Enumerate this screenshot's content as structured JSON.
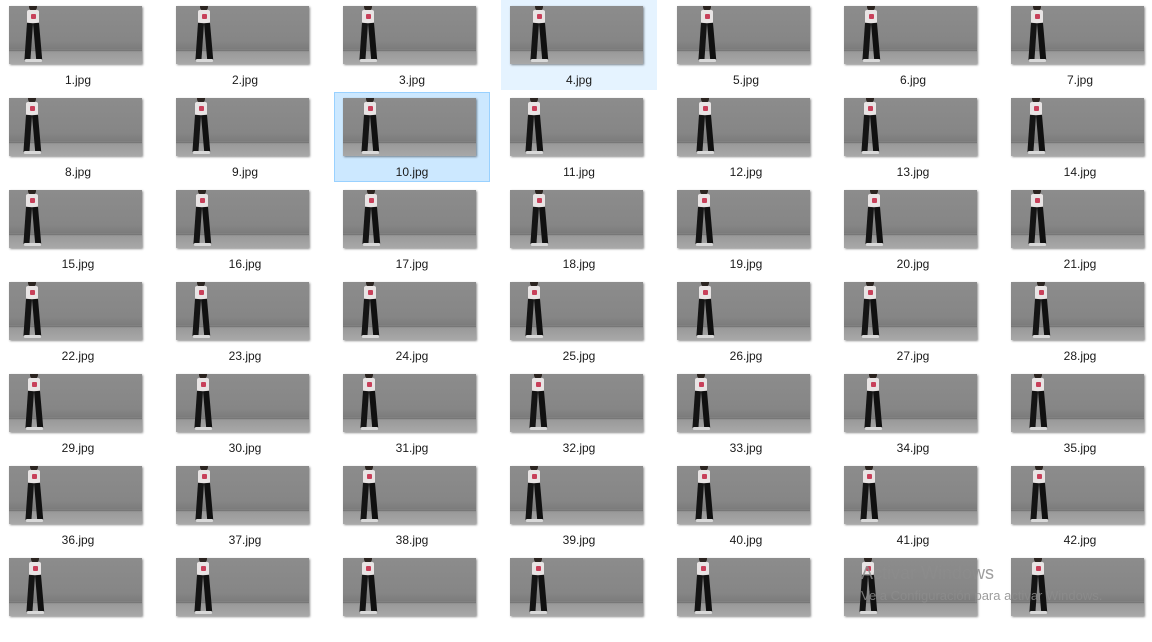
{
  "files": [
    {
      "name": "1.jpg"
    },
    {
      "name": "2.jpg"
    },
    {
      "name": "3.jpg"
    },
    {
      "name": "4.jpg",
      "state": "hover"
    },
    {
      "name": "5.jpg"
    },
    {
      "name": "6.jpg"
    },
    {
      "name": "7.jpg"
    },
    {
      "name": "8.jpg"
    },
    {
      "name": "9.jpg"
    },
    {
      "name": "10.jpg",
      "state": "selected"
    },
    {
      "name": "11.jpg"
    },
    {
      "name": "12.jpg"
    },
    {
      "name": "13.jpg"
    },
    {
      "name": "14.jpg"
    },
    {
      "name": "15.jpg"
    },
    {
      "name": "16.jpg"
    },
    {
      "name": "17.jpg"
    },
    {
      "name": "18.jpg"
    },
    {
      "name": "19.jpg"
    },
    {
      "name": "20.jpg"
    },
    {
      "name": "21.jpg"
    },
    {
      "name": "22.jpg"
    },
    {
      "name": "23.jpg"
    },
    {
      "name": "24.jpg"
    },
    {
      "name": "25.jpg"
    },
    {
      "name": "26.jpg"
    },
    {
      "name": "27.jpg"
    },
    {
      "name": "28.jpg"
    },
    {
      "name": "29.jpg"
    },
    {
      "name": "30.jpg"
    },
    {
      "name": "31.jpg"
    },
    {
      "name": "32.jpg"
    },
    {
      "name": "33.jpg"
    },
    {
      "name": "34.jpg"
    },
    {
      "name": "35.jpg"
    },
    {
      "name": "36.jpg"
    },
    {
      "name": "37.jpg"
    },
    {
      "name": "38.jpg"
    },
    {
      "name": "39.jpg"
    },
    {
      "name": "40.jpg"
    },
    {
      "name": "41.jpg"
    },
    {
      "name": "42.jpg"
    },
    {
      "name": ""
    },
    {
      "name": ""
    },
    {
      "name": ""
    },
    {
      "name": ""
    },
    {
      "name": ""
    },
    {
      "name": ""
    },
    {
      "name": ""
    }
  ],
  "watermark": {
    "title": "Activar Windows",
    "subtitle": "Ve a Configuración para activar Windows."
  },
  "colors": {
    "hover_bg": "#e5f3ff",
    "selected_bg": "#cce8ff",
    "selected_border": "#99d1ff"
  }
}
